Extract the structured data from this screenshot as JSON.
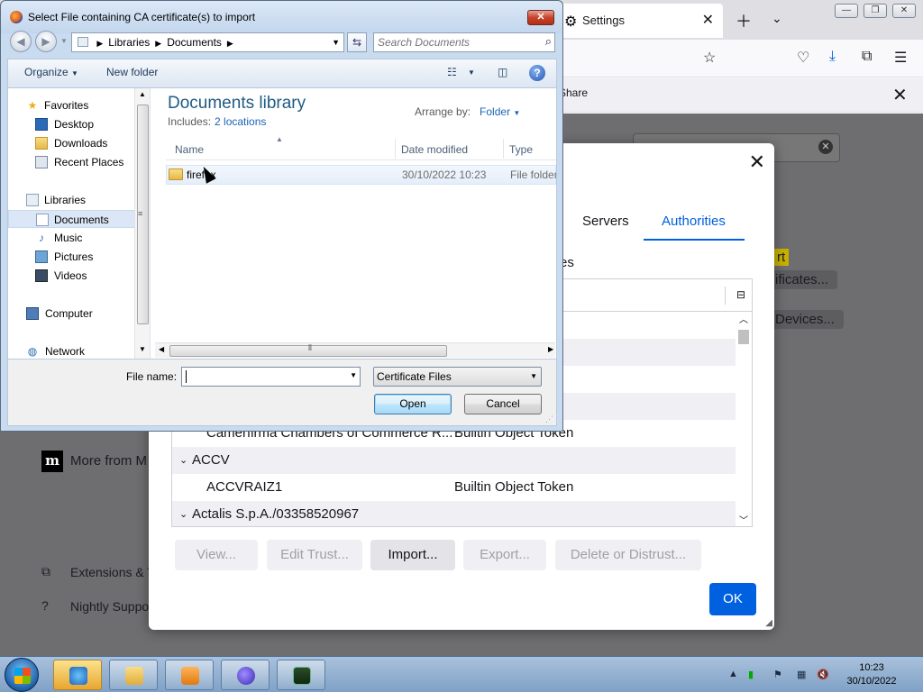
{
  "firefox": {
    "tab_title": "Settings",
    "tab_icon": "gear-icon",
    "notice_share": "Share",
    "more_from": "More from M",
    "sidebar_extensions": "Extensions & T",
    "sidebar_support": "Nightly Suppo",
    "peek_ert": "rt",
    "peek_certificates": "ificates...",
    "peek_devices": "Devices..."
  },
  "cert_manager": {
    "tabs": [
      {
        "label": "Servers"
      },
      {
        "label": "Authorities"
      }
    ],
    "intro_fragment": "es",
    "rows": [
      {
        "kind": "cert",
        "name": "",
        "device": "en"
      },
      {
        "kind": "cert",
        "name": "",
        "device": "en"
      },
      {
        "kind": "cert",
        "name": "Camerfirma Chambers of Commerce R...",
        "device": "Builtin Object Token"
      },
      {
        "kind": "org",
        "name": "ACCV"
      },
      {
        "kind": "cert",
        "name": "ACCVRAIZ1",
        "device": "Builtin Object Token"
      },
      {
        "kind": "org",
        "name": "Actalis S.p.A./03358520967"
      }
    ],
    "buttons": {
      "view": "View...",
      "edit_trust": "Edit Trust...",
      "import": "Import...",
      "export": "Export...",
      "delete": "Delete or Distrust...",
      "ok": "OK"
    }
  },
  "file_dialog": {
    "title": "Select File containing CA certificate(s) to import",
    "breadcrumb": [
      "Libraries",
      "Documents"
    ],
    "search_placeholder": "Search Documents",
    "toolbar": {
      "organize": "Organize",
      "new_folder": "New folder"
    },
    "tree": {
      "favorites": "Favorites",
      "desktop": "Desktop",
      "downloads": "Downloads",
      "recent_places": "Recent Places",
      "libraries": "Libraries",
      "documents": "Documents",
      "music": "Music",
      "pictures": "Pictures",
      "videos": "Videos",
      "computer": "Computer",
      "network": "Network"
    },
    "library": {
      "title": "Documents library",
      "includes_label": "Includes:",
      "includes_link": "2 locations",
      "arrange_label": "Arrange by:",
      "arrange_value": "Folder"
    },
    "columns": [
      "Name",
      "Date modified",
      "Type"
    ],
    "files": [
      {
        "name": "firefox",
        "date": "30/10/2022 10:23",
        "type": "File folder"
      }
    ],
    "file_name_label": "File name:",
    "file_name_value": "",
    "filter": "Certificate Files",
    "open": "Open",
    "cancel": "Cancel"
  },
  "taskbar": {
    "time": "10:23",
    "date": "30/10/2022"
  }
}
